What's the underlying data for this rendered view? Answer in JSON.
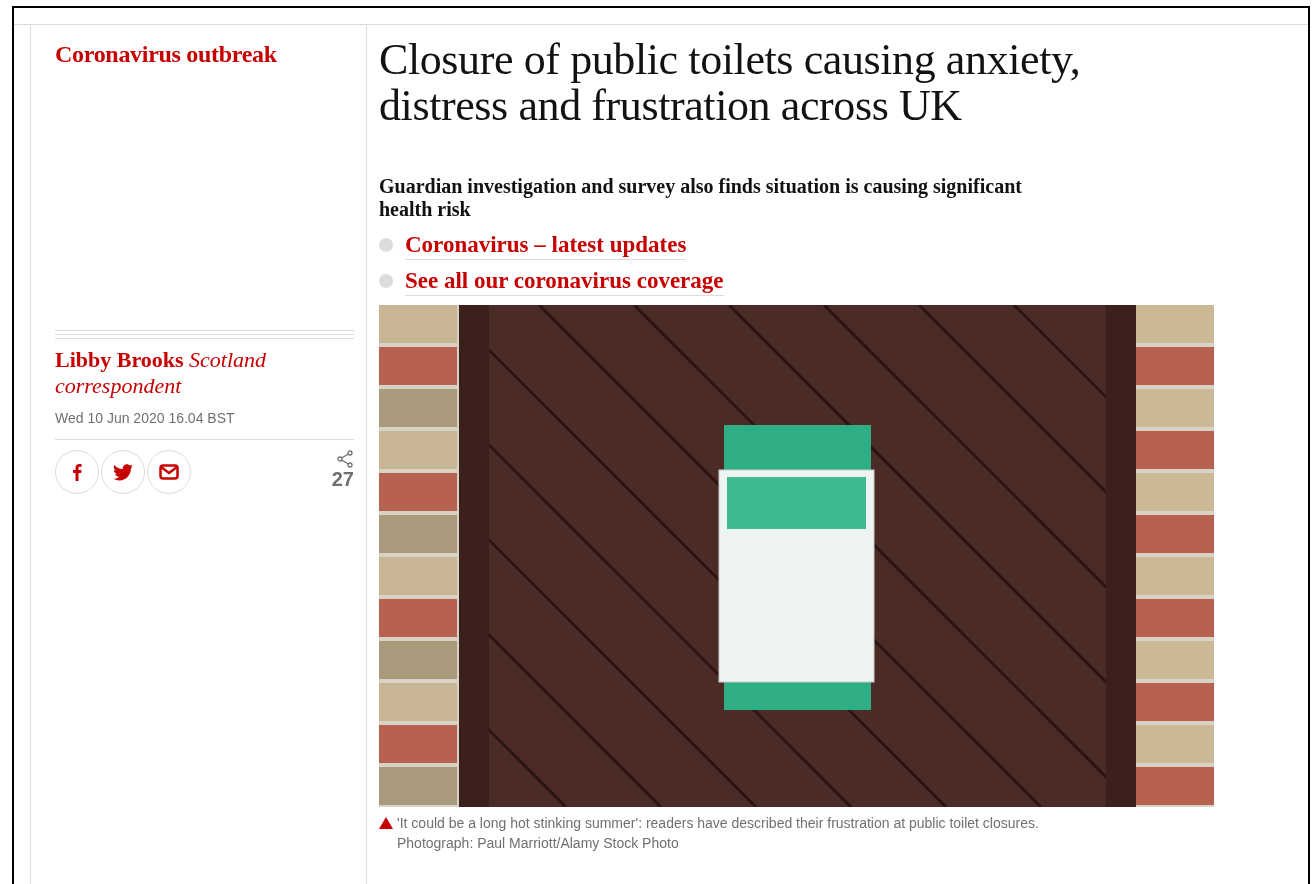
{
  "kicker": "Coronavirus outbreak",
  "headline": "Closure of public toilets causing anxiety, distress and frustration across UK",
  "standfirst": "Guardian investigation and survey also finds situation is causing significant health risk",
  "links": [
    "Coronavirus – latest updates",
    "See all our coronavirus coverage"
  ],
  "byline": "**Libby Brooks** *Scotland correspondent*",
  "dateline": "Wed 10 Jun 2020 16.04 BST",
  "share": {
    "count": "27",
    "buttons": [
      {
        "kind": "facebook"
      },
      {
        "kind": "twitter"
      },
      {
        "kind": "email"
      }
    ]
  },
  "caption": {
    "text": "'It could be a long hot stinking summer': readers have described their frustration at public toilet closures.",
    "credit": "Photograph: Paul Marriott/Alamy Stock Photo"
  }
}
